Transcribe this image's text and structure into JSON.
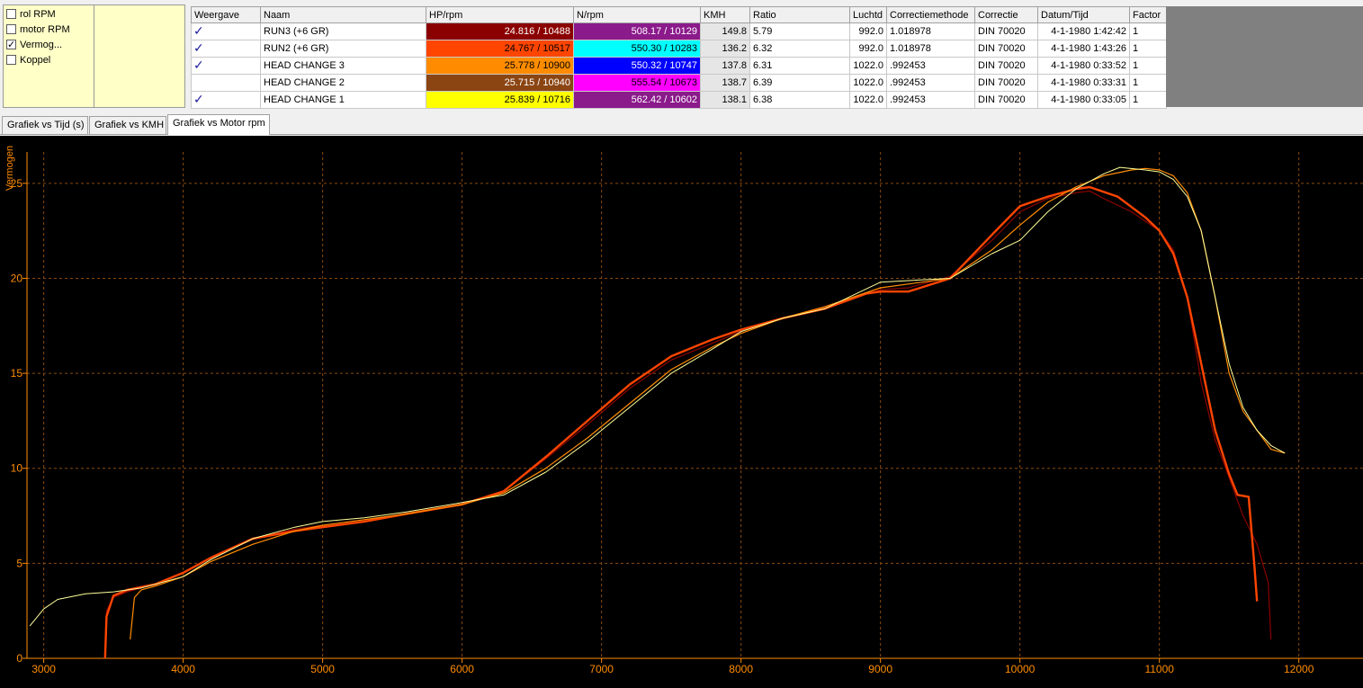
{
  "checkboxes": [
    {
      "label": "rol RPM",
      "checked": false
    },
    {
      "label": "motor RPM",
      "checked": false
    },
    {
      "label": "Vermog...",
      "checked": true
    },
    {
      "label": "Koppel",
      "checked": false
    }
  ],
  "table": {
    "headers": [
      "Weergave",
      "Naam",
      "HP/rpm",
      "N/rpm",
      "KMH",
      "Ratio",
      "Luchtd",
      "Correctiemethode",
      "Correctie",
      "Datum/Tijd",
      "Factor"
    ],
    "rows": [
      {
        "visible": true,
        "name": "RUN3 (+6 GR)",
        "hp": "24.816 / 10488",
        "hp_color": "#8b0000",
        "hp_text": "#ffffff",
        "nm": "508.17 / 10129",
        "nm_color": "#8b1a8b",
        "nm_text": "#ffffff",
        "kmh": "149.8",
        "ratio": "5.79",
        "luchtd": "992.0",
        "methode": "1.018978",
        "correctie": "DIN 70020",
        "datum": "4-1-1980 1:42:42",
        "factor": "1"
      },
      {
        "visible": true,
        "name": "RUN2 (+6 GR)",
        "hp": "24.767 / 10517",
        "hp_color": "#ff4500",
        "hp_text": "#000000",
        "nm": "550.30 / 10283",
        "nm_color": "#00ffff",
        "nm_text": "#000000",
        "kmh": "136.2",
        "ratio": "6.32",
        "luchtd": "992.0",
        "methode": "1.018978",
        "correctie": "DIN 70020",
        "datum": "4-1-1980 1:43:26",
        "factor": "1"
      },
      {
        "visible": true,
        "name": "HEAD CHANGE 3",
        "hp": "25.778 / 10900",
        "hp_color": "#ff8c00",
        "hp_text": "#000000",
        "nm": "550.32 / 10747",
        "nm_color": "#0000ff",
        "nm_text": "#ffffff",
        "kmh": "137.8",
        "ratio": "6.31",
        "luchtd": "1022.0",
        "methode": ".992453",
        "correctie": "DIN 70020",
        "datum": "4-1-1980 0:33:52",
        "factor": "1"
      },
      {
        "visible": false,
        "name": "HEAD CHANGE 2",
        "hp": "25.715 / 10940",
        "hp_color": "#8b4513",
        "hp_text": "#ffffff",
        "nm": "555.54 / 10673",
        "nm_color": "#ff00ff",
        "nm_text": "#000000",
        "kmh": "138.7",
        "ratio": "6.39",
        "luchtd": "1022.0",
        "methode": ".992453",
        "correctie": "DIN 70020",
        "datum": "4-1-1980 0:33:31",
        "factor": "1"
      },
      {
        "visible": true,
        "name": "HEAD CHANGE 1",
        "hp": "25.839 / 10716",
        "hp_color": "#ffff00",
        "hp_text": "#000000",
        "nm": "562.42 / 10602",
        "nm_color": "#8b1a8b",
        "nm_text": "#ffffff",
        "kmh": "138.1",
        "ratio": "6.38",
        "luchtd": "1022.0",
        "methode": ".992453",
        "correctie": "DIN 70020",
        "datum": "4-1-1980 0:33:05",
        "factor": "1"
      }
    ]
  },
  "tabs": [
    {
      "label": "Grafiek vs Tijd (s)",
      "active": false
    },
    {
      "label": "Grafiek vs KMH",
      "active": false
    },
    {
      "label": "Grafiek vs Motor rpm",
      "active": true
    }
  ],
  "chart_data": {
    "type": "line",
    "ylabel": "Vermogen",
    "xlabel": "",
    "xlim": [
      2880,
      12460
    ],
    "ylim": [
      0,
      27.5
    ],
    "xticks": [
      3000,
      4000,
      5000,
      6000,
      7000,
      8000,
      9000,
      10000,
      11000,
      12000
    ],
    "yticks": [
      0,
      5,
      10,
      15,
      20,
      25
    ],
    "grid": true,
    "axis_color": "#ff8c00",
    "background": "#000000",
    "series": [
      {
        "color": "#8b0000",
        "width": 1.2,
        "points": [
          [
            3440,
            0
          ],
          [
            3450,
            2.5
          ],
          [
            3500,
            3.2
          ],
          [
            3600,
            3.5
          ],
          [
            3800,
            3.9
          ],
          [
            4000,
            4.5
          ],
          [
            4200,
            5.3
          ],
          [
            4500,
            6.3
          ],
          [
            4800,
            6.8
          ],
          [
            5000,
            7.0
          ],
          [
            5300,
            7.3
          ],
          [
            5600,
            7.6
          ],
          [
            6000,
            8.1
          ],
          [
            6300,
            8.8
          ],
          [
            6600,
            10.5
          ],
          [
            6900,
            12.3
          ],
          [
            7200,
            14.2
          ],
          [
            7500,
            15.7
          ],
          [
            7800,
            16.6
          ],
          [
            8000,
            17.2
          ],
          [
            8300,
            17.9
          ],
          [
            8600,
            18.5
          ],
          [
            9000,
            19.4
          ],
          [
            9200,
            19.5
          ],
          [
            9500,
            20.1
          ],
          [
            9800,
            22.0
          ],
          [
            10000,
            23.5
          ],
          [
            10200,
            24.2
          ],
          [
            10400,
            24.5
          ],
          [
            10500,
            24.6
          ],
          [
            10600,
            24.2
          ],
          [
            10800,
            23.5
          ],
          [
            11000,
            22.5
          ],
          [
            11100,
            21.5
          ],
          [
            11200,
            19.0
          ],
          [
            11300,
            14.5
          ],
          [
            11400,
            11.5
          ],
          [
            11500,
            9.5
          ],
          [
            11600,
            7.5
          ],
          [
            11700,
            6.0
          ],
          [
            11780,
            4.0
          ],
          [
            11800,
            1.0
          ]
        ]
      },
      {
        "color": "#ff4500",
        "width": 2.4,
        "points": [
          [
            3440,
            0
          ],
          [
            3450,
            2.2
          ],
          [
            3500,
            3.3
          ],
          [
            3600,
            3.6
          ],
          [
            3800,
            3.9
          ],
          [
            4000,
            4.5
          ],
          [
            4200,
            5.3
          ],
          [
            4500,
            6.3
          ],
          [
            4800,
            6.7
          ],
          [
            5000,
            6.9
          ],
          [
            5300,
            7.2
          ],
          [
            5600,
            7.6
          ],
          [
            6000,
            8.1
          ],
          [
            6300,
            8.8
          ],
          [
            6600,
            10.6
          ],
          [
            6900,
            12.5
          ],
          [
            7200,
            14.4
          ],
          [
            7500,
            15.9
          ],
          [
            7800,
            16.8
          ],
          [
            8000,
            17.3
          ],
          [
            8300,
            17.9
          ],
          [
            8600,
            18.4
          ],
          [
            8900,
            19.2
          ],
          [
            9000,
            19.3
          ],
          [
            9200,
            19.3
          ],
          [
            9500,
            20.0
          ],
          [
            9800,
            22.3
          ],
          [
            10000,
            23.8
          ],
          [
            10200,
            24.3
          ],
          [
            10400,
            24.7
          ],
          [
            10500,
            24.8
          ],
          [
            10700,
            24.3
          ],
          [
            10900,
            23.2
          ],
          [
            11000,
            22.5
          ],
          [
            11100,
            21.3
          ],
          [
            11200,
            19.0
          ],
          [
            11300,
            15.5
          ],
          [
            11400,
            12.0
          ],
          [
            11500,
            9.7
          ],
          [
            11560,
            8.6
          ],
          [
            11640,
            8.5
          ],
          [
            11680,
            5.0
          ],
          [
            11700,
            3.0
          ]
        ]
      },
      {
        "color": "#ff8c00",
        "width": 1.2,
        "points": [
          [
            3620,
            1.0
          ],
          [
            3650,
            3.2
          ],
          [
            3700,
            3.6
          ],
          [
            3800,
            3.8
          ],
          [
            4000,
            4.3
          ],
          [
            4200,
            5.1
          ],
          [
            4500,
            6.0
          ],
          [
            4800,
            6.7
          ],
          [
            5000,
            7.0
          ],
          [
            5300,
            7.3
          ],
          [
            5600,
            7.6
          ],
          [
            6000,
            8.1
          ],
          [
            6300,
            8.7
          ],
          [
            6600,
            10.0
          ],
          [
            6900,
            11.6
          ],
          [
            7200,
            13.4
          ],
          [
            7500,
            15.2
          ],
          [
            7800,
            16.4
          ],
          [
            8000,
            17.1
          ],
          [
            8300,
            17.9
          ],
          [
            8600,
            18.5
          ],
          [
            9000,
            19.5
          ],
          [
            9500,
            20.0
          ],
          [
            9800,
            21.5
          ],
          [
            10000,
            22.8
          ],
          [
            10200,
            24.0
          ],
          [
            10400,
            24.8
          ],
          [
            10600,
            25.4
          ],
          [
            10800,
            25.7
          ],
          [
            10900,
            25.78
          ],
          [
            11000,
            25.7
          ],
          [
            11100,
            25.4
          ],
          [
            11200,
            24.5
          ],
          [
            11300,
            22.5
          ],
          [
            11400,
            19.0
          ],
          [
            11500,
            15.0
          ],
          [
            11600,
            13.0
          ],
          [
            11700,
            12.0
          ],
          [
            11800,
            11.0
          ],
          [
            11900,
            10.8
          ]
        ]
      },
      {
        "color": "#ffff99",
        "width": 1.0,
        "points": [
          [
            2900,
            1.7
          ],
          [
            3000,
            2.6
          ],
          [
            3100,
            3.1
          ],
          [
            3300,
            3.4
          ],
          [
            3500,
            3.5
          ],
          [
            3700,
            3.7
          ],
          [
            4000,
            4.3
          ],
          [
            4200,
            5.2
          ],
          [
            4500,
            6.3
          ],
          [
            4800,
            6.9
          ],
          [
            5000,
            7.2
          ],
          [
            5300,
            7.4
          ],
          [
            5600,
            7.7
          ],
          [
            6000,
            8.2
          ],
          [
            6300,
            8.6
          ],
          [
            6600,
            9.8
          ],
          [
            6900,
            11.4
          ],
          [
            7200,
            13.2
          ],
          [
            7500,
            15.0
          ],
          [
            7800,
            16.3
          ],
          [
            8000,
            17.2
          ],
          [
            8300,
            17.9
          ],
          [
            8600,
            18.4
          ],
          [
            9000,
            19.8
          ],
          [
            9500,
            20.0
          ],
          [
            9800,
            21.3
          ],
          [
            10000,
            22.0
          ],
          [
            10200,
            23.5
          ],
          [
            10400,
            24.7
          ],
          [
            10600,
            25.5
          ],
          [
            10716,
            25.84
          ],
          [
            10900,
            25.7
          ],
          [
            11000,
            25.6
          ],
          [
            11100,
            25.2
          ],
          [
            11200,
            24.3
          ],
          [
            11300,
            22.5
          ],
          [
            11400,
            19.0
          ],
          [
            11500,
            15.5
          ],
          [
            11600,
            13.2
          ],
          [
            11700,
            12.0
          ],
          [
            11800,
            11.2
          ],
          [
            11900,
            10.8
          ]
        ]
      }
    ]
  }
}
